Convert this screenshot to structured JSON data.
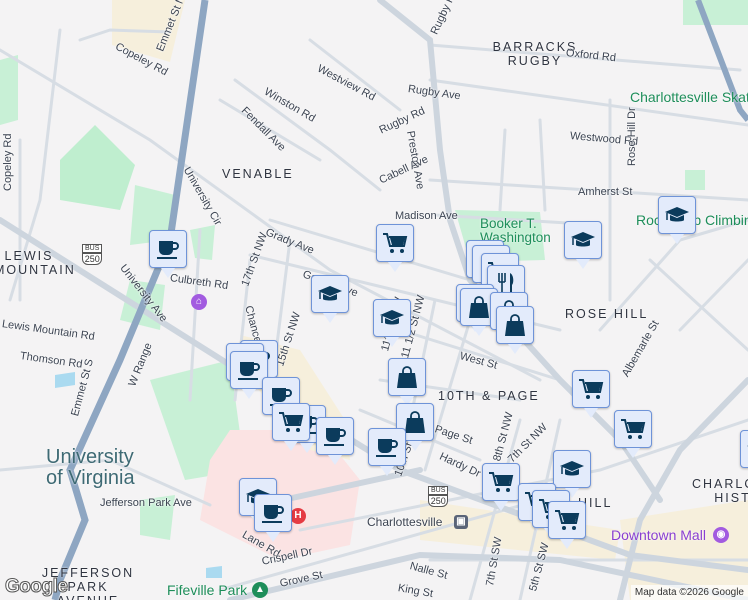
{
  "neighborhoods": [
    "VENABLE",
    "BARRACKS RUGBY",
    "LEWIS MOUNTAIN",
    "ROSE HILL",
    "10TH & PAGE",
    "JEFFERSON PARK AVENUE",
    "CHARLOTTESVILLE HISTORIC",
    "HILL"
  ],
  "streets": [
    "Emmet St N",
    "Emmet St S",
    "Copeley Rd",
    "Westview Rd",
    "Winston Rd",
    "Fendall Ave",
    "Rugby Rd",
    "Rugby Ave",
    "Oxford Rd",
    "Westwood Rd",
    "Preston Ave",
    "Cabell Ave",
    "Amherst St",
    "Rose Hill Dr",
    "Madison Ave",
    "Grady Ave",
    "University Cir",
    "17th St NW",
    "15th St NW",
    "Culbreth Rd",
    "University Ave",
    "Lewis Mountain Rd",
    "Thomson Rd",
    "W Range",
    "Jefferson Park Ave",
    "Lane Rd",
    "Crispell Dr",
    "Grove St",
    "King St",
    "Nalle St",
    "West St",
    "11th St NW",
    "11 1/2 St NW",
    "Page St",
    "Hardy Dr",
    "8th St NW",
    "7th St NW",
    "7th St SW",
    "5th St SW",
    "Albemarle St",
    "10th St",
    "Chancellor St",
    "Gordon Ave"
  ],
  "places": {
    "university": "University of Virginia",
    "park1": "Booker T. Washington Park",
    "skate": "Charlottesville Skat",
    "climb": "Rocky Top Climbing",
    "fifeville": "Fifeville Park",
    "downtown": "Downtown Mall",
    "station": "Charlottesville"
  },
  "shields": {
    "bus": "BUS",
    "route": "250"
  },
  "attribution": "Map data ©2026 Google",
  "logo": "Google",
  "marker_types": [
    "coffee",
    "cart",
    "graduation",
    "bag",
    "restaurant"
  ],
  "colors": {
    "marker_bg": "#e3ebfb",
    "marker_icon": "#0b3b5c",
    "highway": "#8ea6c2",
    "park": "#c8f0d6"
  }
}
